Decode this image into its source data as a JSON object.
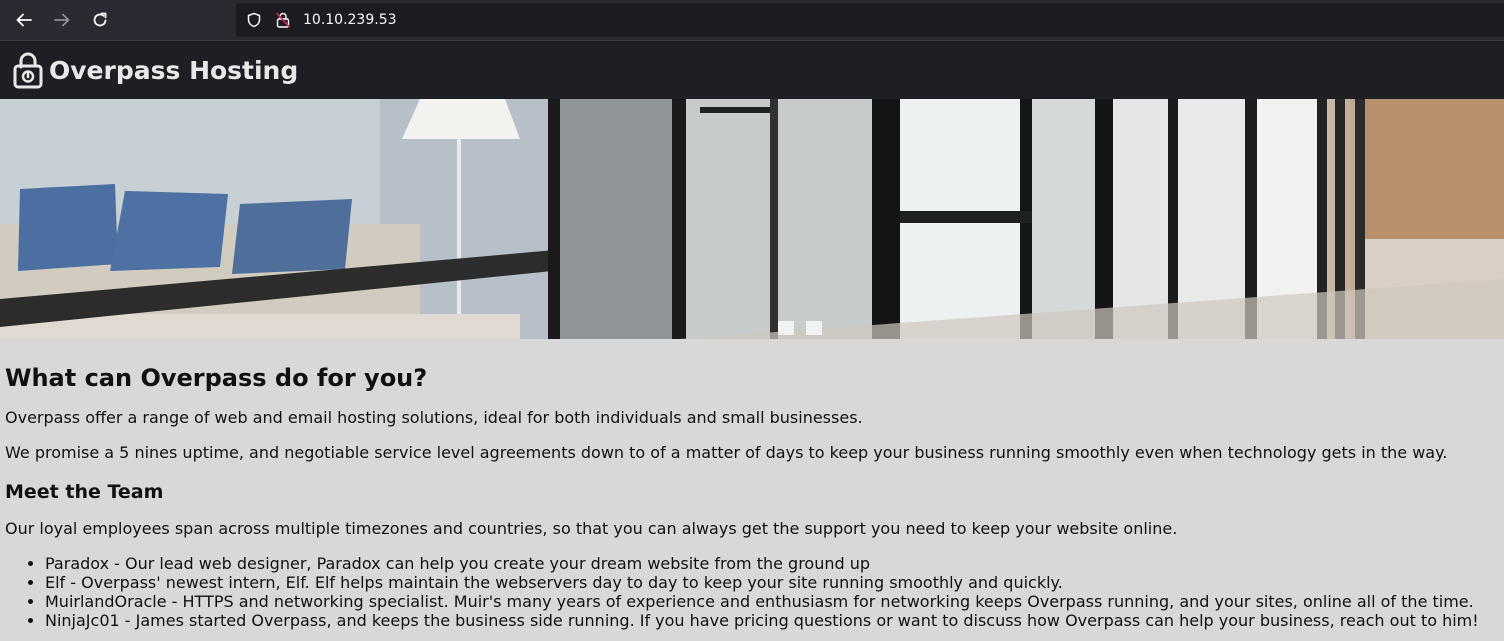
{
  "browser": {
    "url": "10.10.239.53"
  },
  "site": {
    "title": "Overpass Hosting",
    "logo_icon": "padlock-icon"
  },
  "hero": {
    "image": "office-interior-photo"
  },
  "main": {
    "heading": "What can Overpass do for you?",
    "intro": "Overpass offer a range of web and email hosting solutions, ideal for both individuals and small businesses.",
    "promise": "We promise a 5 nines uptime, and negotiable service level agreements down to of a matter of days to keep your business running smoothly even when technology gets in the way.",
    "team_heading": "Meet the Team",
    "team_intro": "Our loyal employees span across multiple timezones and countries, so that you can always get the support you need to keep your website online.",
    "team": [
      "Paradox - Our lead web designer, Paradox can help you create your dream website from the ground up",
      "Elf - Overpass' newest intern, Elf. Elf helps maintain the webservers day to day to keep your site running smoothly and quickly.",
      "MuirlandOracle - HTTPS and networking specialist. Muir's many years of experience and enthusiasm for networking keeps Overpass running, and your sites, online all of the time.",
      "NinjaJc01 - James started Overpass, and keeps the business side running. If you have pricing questions or want to discuss how Overpass can help your business, reach out to him!"
    ]
  },
  "colors": {
    "page_bg": "#d8d8d8",
    "header_bg": "#1e1f24",
    "browser_bg": "#2b2a33"
  }
}
